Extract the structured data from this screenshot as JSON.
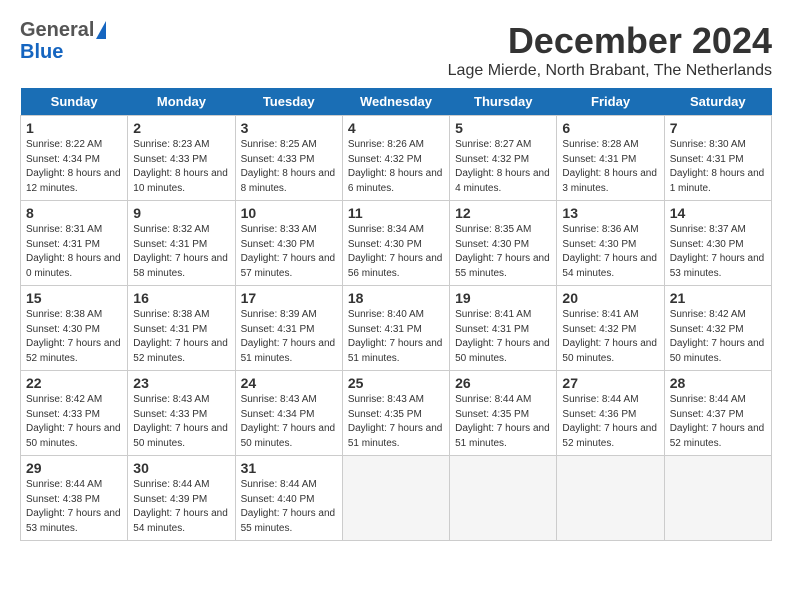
{
  "header": {
    "logo_general": "General",
    "logo_blue": "Blue",
    "month": "December 2024",
    "location": "Lage Mierde, North Brabant, The Netherlands"
  },
  "weekdays": [
    "Sunday",
    "Monday",
    "Tuesday",
    "Wednesday",
    "Thursday",
    "Friday",
    "Saturday"
  ],
  "weeks": [
    [
      {
        "day": "1",
        "sunrise": "8:22 AM",
        "sunset": "4:34 PM",
        "daylight": "8 hours and 12 minutes"
      },
      {
        "day": "2",
        "sunrise": "8:23 AM",
        "sunset": "4:33 PM",
        "daylight": "8 hours and 10 minutes"
      },
      {
        "day": "3",
        "sunrise": "8:25 AM",
        "sunset": "4:33 PM",
        "daylight": "8 hours and 8 minutes"
      },
      {
        "day": "4",
        "sunrise": "8:26 AM",
        "sunset": "4:32 PM",
        "daylight": "8 hours and 6 minutes"
      },
      {
        "day": "5",
        "sunrise": "8:27 AM",
        "sunset": "4:32 PM",
        "daylight": "8 hours and 4 minutes"
      },
      {
        "day": "6",
        "sunrise": "8:28 AM",
        "sunset": "4:31 PM",
        "daylight": "8 hours and 3 minutes"
      },
      {
        "day": "7",
        "sunrise": "8:30 AM",
        "sunset": "4:31 PM",
        "daylight": "8 hours and 1 minute"
      }
    ],
    [
      {
        "day": "8",
        "sunrise": "8:31 AM",
        "sunset": "4:31 PM",
        "daylight": "8 hours and 0 minutes"
      },
      {
        "day": "9",
        "sunrise": "8:32 AM",
        "sunset": "4:31 PM",
        "daylight": "7 hours and 58 minutes"
      },
      {
        "day": "10",
        "sunrise": "8:33 AM",
        "sunset": "4:30 PM",
        "daylight": "7 hours and 57 minutes"
      },
      {
        "day": "11",
        "sunrise": "8:34 AM",
        "sunset": "4:30 PM",
        "daylight": "7 hours and 56 minutes"
      },
      {
        "day": "12",
        "sunrise": "8:35 AM",
        "sunset": "4:30 PM",
        "daylight": "7 hours and 55 minutes"
      },
      {
        "day": "13",
        "sunrise": "8:36 AM",
        "sunset": "4:30 PM",
        "daylight": "7 hours and 54 minutes"
      },
      {
        "day": "14",
        "sunrise": "8:37 AM",
        "sunset": "4:30 PM",
        "daylight": "7 hours and 53 minutes"
      }
    ],
    [
      {
        "day": "15",
        "sunrise": "8:38 AM",
        "sunset": "4:30 PM",
        "daylight": "7 hours and 52 minutes"
      },
      {
        "day": "16",
        "sunrise": "8:38 AM",
        "sunset": "4:31 PM",
        "daylight": "7 hours and 52 minutes"
      },
      {
        "day": "17",
        "sunrise": "8:39 AM",
        "sunset": "4:31 PM",
        "daylight": "7 hours and 51 minutes"
      },
      {
        "day": "18",
        "sunrise": "8:40 AM",
        "sunset": "4:31 PM",
        "daylight": "7 hours and 51 minutes"
      },
      {
        "day": "19",
        "sunrise": "8:41 AM",
        "sunset": "4:31 PM",
        "daylight": "7 hours and 50 minutes"
      },
      {
        "day": "20",
        "sunrise": "8:41 AM",
        "sunset": "4:32 PM",
        "daylight": "7 hours and 50 minutes"
      },
      {
        "day": "21",
        "sunrise": "8:42 AM",
        "sunset": "4:32 PM",
        "daylight": "7 hours and 50 minutes"
      }
    ],
    [
      {
        "day": "22",
        "sunrise": "8:42 AM",
        "sunset": "4:33 PM",
        "daylight": "7 hours and 50 minutes"
      },
      {
        "day": "23",
        "sunrise": "8:43 AM",
        "sunset": "4:33 PM",
        "daylight": "7 hours and 50 minutes"
      },
      {
        "day": "24",
        "sunrise": "8:43 AM",
        "sunset": "4:34 PM",
        "daylight": "7 hours and 50 minutes"
      },
      {
        "day": "25",
        "sunrise": "8:43 AM",
        "sunset": "4:35 PM",
        "daylight": "7 hours and 51 minutes"
      },
      {
        "day": "26",
        "sunrise": "8:44 AM",
        "sunset": "4:35 PM",
        "daylight": "7 hours and 51 minutes"
      },
      {
        "day": "27",
        "sunrise": "8:44 AM",
        "sunset": "4:36 PM",
        "daylight": "7 hours and 52 minutes"
      },
      {
        "day": "28",
        "sunrise": "8:44 AM",
        "sunset": "4:37 PM",
        "daylight": "7 hours and 52 minutes"
      }
    ],
    [
      {
        "day": "29",
        "sunrise": "8:44 AM",
        "sunset": "4:38 PM",
        "daylight": "7 hours and 53 minutes"
      },
      {
        "day": "30",
        "sunrise": "8:44 AM",
        "sunset": "4:39 PM",
        "daylight": "7 hours and 54 minutes"
      },
      {
        "day": "31",
        "sunrise": "8:44 AM",
        "sunset": "4:40 PM",
        "daylight": "7 hours and 55 minutes"
      },
      null,
      null,
      null,
      null
    ]
  ]
}
